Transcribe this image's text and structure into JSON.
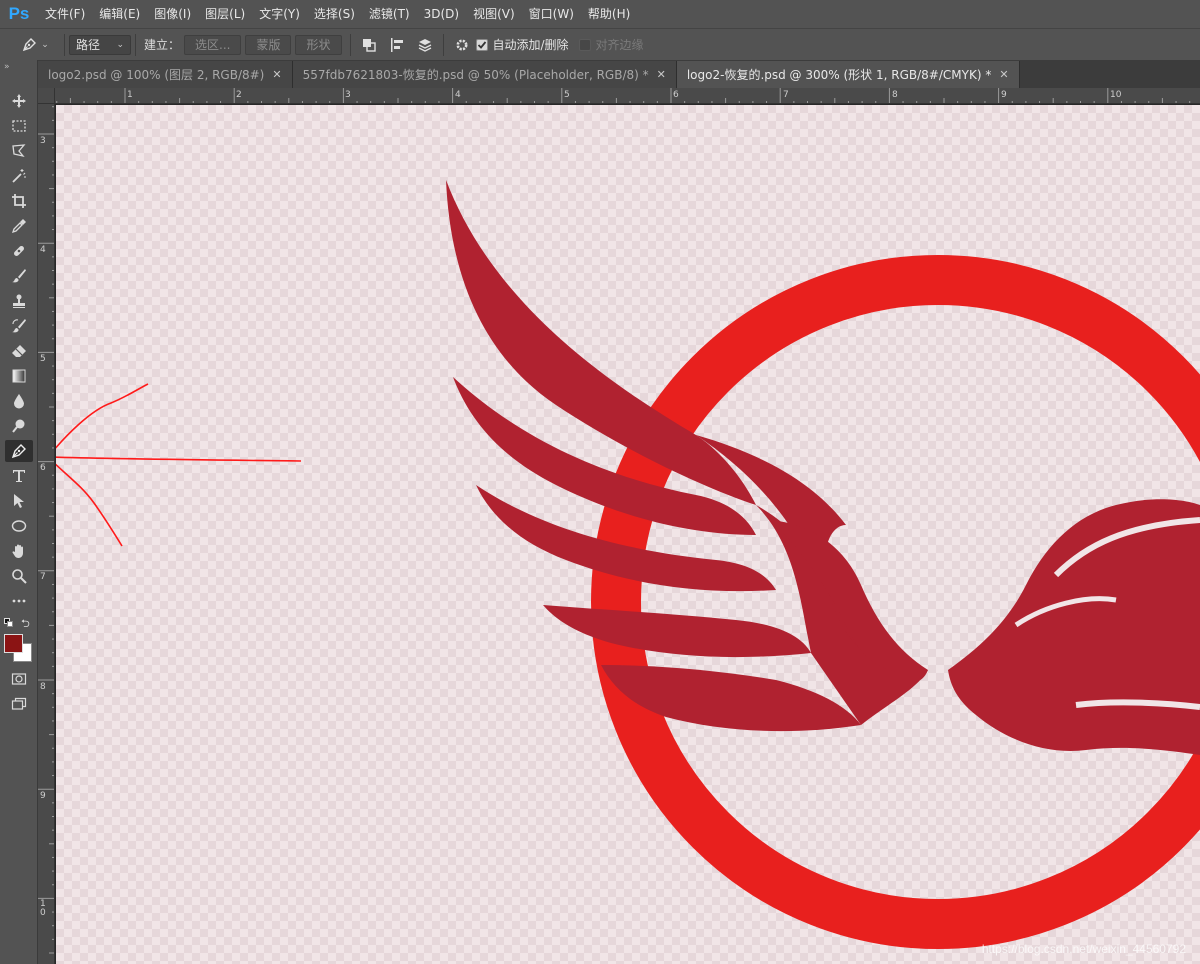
{
  "app": {
    "logo": "Ps"
  },
  "menu": [
    "文件(F)",
    "编辑(E)",
    "图像(I)",
    "图层(L)",
    "文字(Y)",
    "选择(S)",
    "滤镜(T)",
    "3D(D)",
    "视图(V)",
    "窗口(W)",
    "帮助(H)"
  ],
  "options": {
    "mode_value": "路径",
    "build_label": "建立：",
    "selection_label": "选区...",
    "mask_label": "蒙版",
    "shape_label": "形状",
    "auto_add_delete_label": "自动添加/删除",
    "auto_add_delete_checked": true,
    "align_edges_label": "对齐边缘",
    "align_edges_checked": false
  },
  "tabs": [
    {
      "label": "logo2.psd @ 100% (图层 2, RGB/8#)",
      "active": false
    },
    {
      "label": "557fdb7621803-恢复的.psd @ 50% (Placeholder, RGB/8) *",
      "active": false
    },
    {
      "label": "logo2-恢复的.psd @ 300% (形状 1, RGB/8#/CMYK) *",
      "active": true
    }
  ],
  "ruler": {
    "top_labels": [
      "1",
      "2",
      "3",
      "4",
      "5",
      "6",
      "7",
      "8",
      "9",
      "10"
    ],
    "left_labels": [
      "3",
      "4",
      "5",
      "6",
      "7",
      "8",
      "9",
      "1\n0"
    ]
  },
  "colors": {
    "foreground": "#8b1414",
    "background": "#ffffff",
    "ring": "#e8201e",
    "wings": "#b02230",
    "annotation": "#ff1a1a"
  },
  "active_tool": "pen-tool",
  "watermark": "https://blog.csdn.net/weixin_44560792"
}
